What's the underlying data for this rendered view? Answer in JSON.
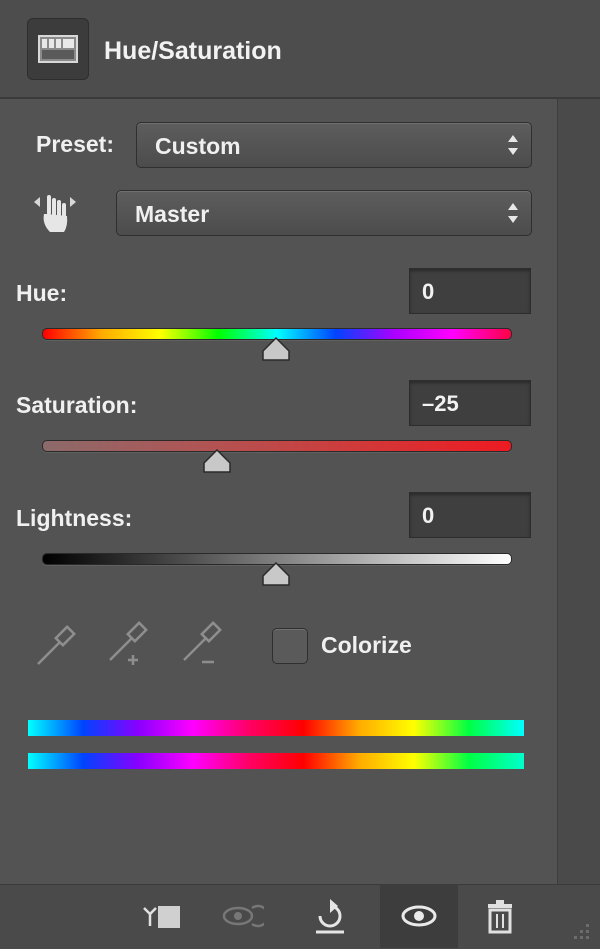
{
  "panel": {
    "title": "Hue/Saturation",
    "icon": "adjustment-layer-icon"
  },
  "preset": {
    "label": "Preset:",
    "value": "Custom"
  },
  "channel": {
    "value": "Master",
    "icon": "targeted-adjustment-hand-icon"
  },
  "sliders": {
    "hue": {
      "label": "Hue:",
      "value": "0",
      "position": 0.5
    },
    "saturation": {
      "label": "Saturation:",
      "value": "–25",
      "position": 0.375
    },
    "lightness": {
      "label": "Lightness:",
      "value": "0",
      "position": 0.5
    }
  },
  "eyedroppers": [
    "eyedropper-icon",
    "eyedropper-add-icon",
    "eyedropper-subtract-icon"
  ],
  "colorize": {
    "label": "Colorize",
    "checked": false
  },
  "footer": {
    "icons": [
      "clip-to-layer-icon",
      "view-previous-state-icon",
      "reset-icon",
      "visibility-eye-icon",
      "delete-trash-icon"
    ]
  },
  "colors": {
    "panel_bg": "#535353",
    "field_bg": "#3f3f3f",
    "text": "#f0f0f0"
  }
}
